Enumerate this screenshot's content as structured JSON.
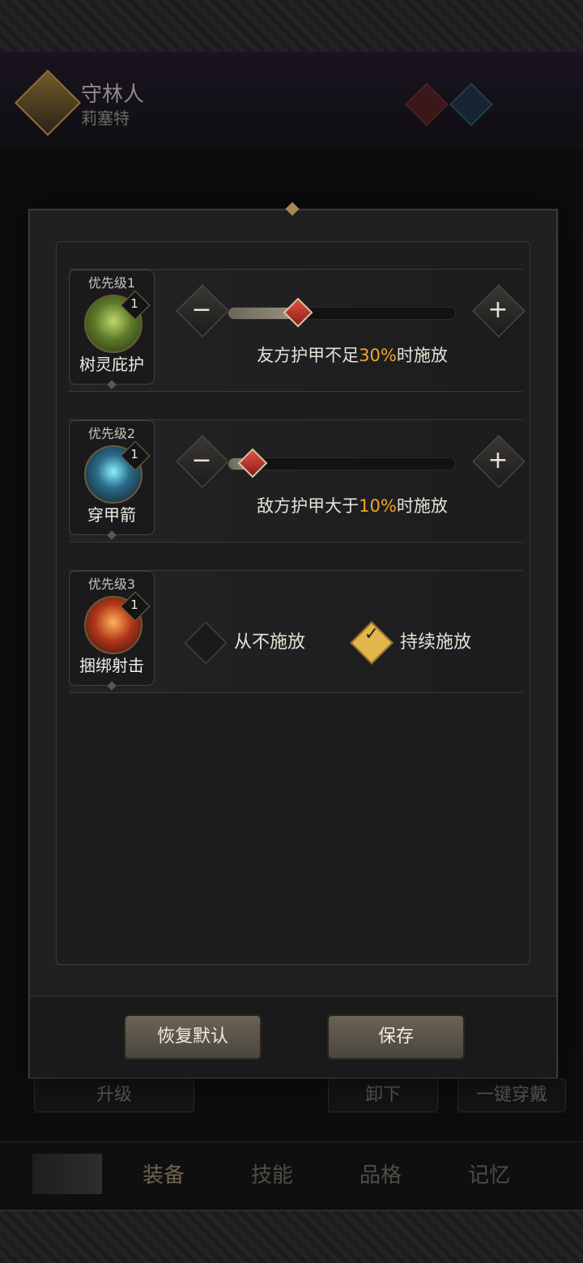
{
  "character": {
    "name": "守林人",
    "subtitle": "莉塞特"
  },
  "skills": [
    {
      "priority": "优先级1",
      "name": "树灵庇护",
      "level": "1",
      "icon": "tree-skill-icon",
      "condition_prefix": "友方护甲不足",
      "condition_value": "30%",
      "condition_suffix": "时施放",
      "slider": 0.3
    },
    {
      "priority": "优先级2",
      "name": "穿甲箭",
      "level": "1",
      "icon": "lightning-arrow-skill-icon",
      "condition_prefix": "敌方护甲大于",
      "condition_value": "10%",
      "condition_suffix": "时施放",
      "slider": 0.1
    },
    {
      "priority": "优先级3",
      "name": "捆绑射击",
      "level": "1",
      "icon": "bind-shot-skill-icon",
      "options": [
        {
          "label": "从不施放",
          "checked": false
        },
        {
          "label": "持续施放",
          "checked": true
        }
      ]
    }
  ],
  "controls": {
    "minus": "−",
    "plus": "+",
    "check": "✓"
  },
  "footer": {
    "restore": "恢复默认",
    "save": "保存"
  },
  "background": {
    "upgrade": "升级",
    "unload": "卸下",
    "equip_all": "一键穿戴"
  },
  "nav": {
    "equip": "装备",
    "skill": "技能",
    "grade": "品格",
    "memory": "记忆"
  },
  "colors": {
    "highlight": "#f0a629",
    "check": "#e4b54a"
  }
}
